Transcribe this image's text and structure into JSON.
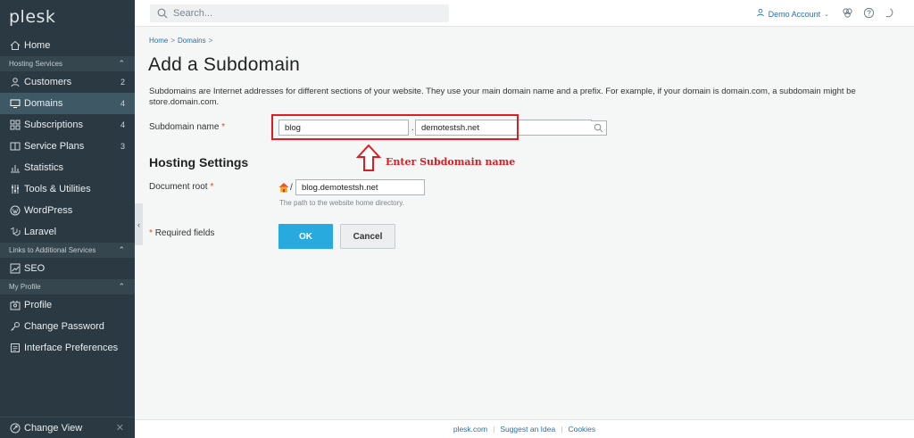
{
  "app": {
    "logo": "plesk"
  },
  "sidebar": {
    "home": "Home",
    "hosting_section": "Hosting Services",
    "items": [
      {
        "label": "Customers",
        "count": "2"
      },
      {
        "label": "Domains",
        "count": "4"
      },
      {
        "label": "Subscriptions",
        "count": "4"
      },
      {
        "label": "Service Plans",
        "count": "3"
      },
      {
        "label": "Statistics",
        "count": ""
      },
      {
        "label": "Tools & Utilities",
        "count": ""
      },
      {
        "label": "WordPress",
        "count": ""
      },
      {
        "label": "Laravel",
        "count": ""
      }
    ],
    "links_section": "Links to Additional Services",
    "seo": "SEO",
    "profile_section": "My Profile",
    "profile_items": [
      "Profile",
      "Change Password",
      "Interface Preferences"
    ],
    "change_view": "Change View"
  },
  "topbar": {
    "search_placeholder": "Search...",
    "account": "Demo Account"
  },
  "breadcrumb": [
    "Home",
    "Domains"
  ],
  "page": {
    "title": "Add a Subdomain",
    "description": "Subdomains are Internet addresses for different sections of your website. They use your main domain name and a prefix. For example, if your domain is domain.com, a subdomain might be store.domain.com.",
    "subdomain_label": "Subdomain name",
    "required_mark": "*",
    "subdomain_value": "blog",
    "domain_value": "demotestsh.net",
    "dot": ".",
    "hosting_heading": "Hosting Settings",
    "docroot_label": "Document root",
    "docroot_slash": "/",
    "docroot_value": "blog.demotestsh.net",
    "docroot_hint": "The path to the website home directory.",
    "required_fields": "Required fields",
    "ok_label": "OK",
    "cancel_label": "Cancel"
  },
  "annotation": {
    "text": "Enter Subdomain name",
    "color": "#e11b22"
  },
  "footer": {
    "links": [
      "plesk.com",
      "Suggest an Idea",
      "Cookies"
    ]
  },
  "colors": {
    "sidebar_bg": "#2b3a42",
    "active_item": "#3e5866",
    "ok_button": "#28aade",
    "link": "#2d6fa4"
  }
}
